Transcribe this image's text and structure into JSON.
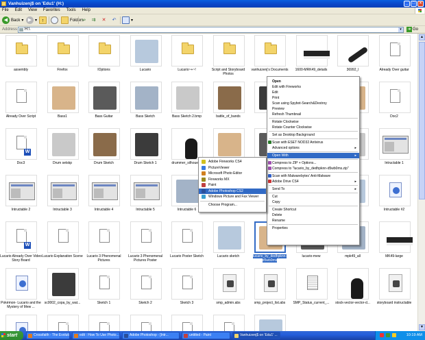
{
  "window": {
    "title": "Vanhuizenj$ on 'Edu1' (H:)",
    "controls": [
      "_",
      "□",
      "×"
    ]
  },
  "menu": [
    "File",
    "Edit",
    "View",
    "Favorites",
    "Tools",
    "Help"
  ],
  "toolbar": {
    "back_label": "Back",
    "folders_label": "Folders"
  },
  "address": {
    "label": "Address",
    "value": "H:\\",
    "go_label": "Go"
  },
  "files": [
    {
      "label": "assembly",
      "icon": "folder"
    },
    {
      "label": "Firefox",
      "icon": "folder"
    },
    {
      "label": "IOptions",
      "icon": "folder"
    },
    {
      "label": "Lucario",
      "icon": "image"
    },
    {
      "label": "Lucario~+~!",
      "icon": "folder"
    },
    {
      "label": "Script and Storyboard Photos",
      "icon": "folder"
    },
    {
      "label": "vanhuizenj's Documents",
      "icon": "folder"
    },
    {
      "label": "1600-MRK49_details",
      "icon": "image"
    },
    {
      "label": "36992_l",
      "icon": "image"
    },
    {
      "label": "Already Over guitar",
      "icon": "doc"
    },
    {
      "label": "Already Over Script",
      "icon": "doc"
    },
    {
      "label": "Bass1",
      "icon": "image"
    },
    {
      "label": "Bass Guitar",
      "icon": "image"
    },
    {
      "label": "Bass Sketch",
      "icon": "image"
    },
    {
      "label": "Bass Sketch 2.bmp",
      "icon": "image"
    },
    {
      "label": "battle_of_bands",
      "icon": "image"
    },
    {
      "label": "d",
      "icon": "image"
    },
    {
      "label": "",
      "icon": "image"
    },
    {
      "label": "",
      "icon": "image"
    },
    {
      "label": "Doc2",
      "icon": "doc"
    },
    {
      "label": "Doc3",
      "icon": "word"
    },
    {
      "label": "Drum setskp",
      "icon": "image"
    },
    {
      "label": "Drum Sketch",
      "icon": "image"
    },
    {
      "label": "Drum Sketch 1",
      "icon": "image"
    },
    {
      "label": "drummer_silhouette",
      "icon": "image"
    },
    {
      "label": "",
      "icon": "image"
    },
    {
      "label": "",
      "icon": "image"
    },
    {
      "label": "",
      "icon": "image"
    },
    {
      "label": "",
      "icon": "image"
    },
    {
      "label": "Intructable 1",
      "icon": "screen"
    },
    {
      "label": "Intructable 2",
      "icon": "screen"
    },
    {
      "label": "Intructable 3",
      "icon": "screen"
    },
    {
      "label": "Intructable 4",
      "icon": "screen"
    },
    {
      "label": "Intructable 5",
      "icon": "screen"
    },
    {
      "label": "Intructable 6",
      "icon": "image"
    },
    {
      "label": "",
      "icon": "image"
    },
    {
      "label": "",
      "icon": "image"
    },
    {
      "label": "",
      "icon": "image"
    },
    {
      "label": "",
      "icon": "image"
    },
    {
      "label": "Intructable #2",
      "icon": "setup"
    },
    {
      "label": "Lucario Already Over Video Story Board",
      "icon": "word"
    },
    {
      "label": "Lucario Explanation Scene",
      "icon": "doc"
    },
    {
      "label": "Lucario 3 Phenomenal Pictures",
      "icon": "doc"
    },
    {
      "label": "Lucario 3 Phenomenal Pictures Poster",
      "icon": "doc"
    },
    {
      "label": "Lucario Poster Sketch",
      "icon": "doc"
    },
    {
      "label": "Lucario sketch",
      "icon": "image"
    },
    {
      "label": "lucario_by_dedhpknn-d5wb0ms",
      "icon": "image"
    },
    {
      "label": "lucario-mew",
      "icon": "image"
    },
    {
      "label": "mpk49_all",
      "icon": "image"
    },
    {
      "label": "MK49-large",
      "icon": "image"
    },
    {
      "label": "Pokémon- Lucario and the Mystery of Mew ...",
      "icon": "setup"
    },
    {
      "label": "sc0002_copa_by_wat...",
      "icon": "image"
    },
    {
      "label": "Sketch 1",
      "icon": "doc"
    },
    {
      "label": "Sketch 2",
      "icon": "doc"
    },
    {
      "label": "Sketch 3",
      "icon": "doc"
    },
    {
      "label": "smp_admin.abs",
      "icon": "util"
    },
    {
      "label": "smp_project_list.abs",
      "icon": "util"
    },
    {
      "label": "SMP_Status_current_...",
      "icon": "txt"
    },
    {
      "label": "stock-vector-vector-d...",
      "icon": "image"
    },
    {
      "label": "storyboard instructable",
      "icon": "util"
    },
    {
      "label": "",
      "icon": "setup"
    },
    {
      "label": "",
      "icon": "doc"
    },
    {
      "label": "",
      "icon": "doc"
    },
    {
      "label": "",
      "icon": "doc"
    },
    {
      "label": "",
      "icon": "doc"
    },
    {
      "label": "",
      "icon": "doc"
    },
    {
      "label": "",
      "icon": "image"
    }
  ],
  "context_menu": {
    "items": [
      {
        "label": "Open",
        "bold": true
      },
      {
        "label": "Edit with Fireworks"
      },
      {
        "label": "Edit"
      },
      {
        "label": "Print"
      },
      {
        "label": "Scan using Spybot-Search&Destroy"
      },
      {
        "label": "Preview"
      },
      {
        "label": "Refresh Thumbnail"
      },
      {
        "sep": true
      },
      {
        "label": "Rotate Clockwise"
      },
      {
        "label": "Rotate Counter Clockwise"
      },
      {
        "sep": true
      },
      {
        "label": "Set as Desktop Background"
      },
      {
        "sep": true
      },
      {
        "label": "Scan with ESET NOD32 Antivirus",
        "icon": "#2a7a2a"
      },
      {
        "label": "Advanced options",
        "submenu": true
      },
      {
        "sep": true
      },
      {
        "label": "Open With",
        "submenu": true,
        "highlight": true
      },
      {
        "sep": true
      },
      {
        "label": "Compress to ZIP + Options...",
        "icon": "#a050b0"
      },
      {
        "label": "Compress to \"lucario_by_dedhpknn-d5wb0ms.zip\"",
        "icon": "#a050b0"
      },
      {
        "sep": true
      },
      {
        "label": "Scan with Malwarebytes' Anti-Malware",
        "icon": "#2f5fc8"
      },
      {
        "label": "Adobe Drive CS4",
        "submenu": true,
        "icon": "#c33"
      },
      {
        "sep": true
      },
      {
        "label": "Send To",
        "submenu": true
      },
      {
        "sep": true
      },
      {
        "label": "Cut"
      },
      {
        "label": "Copy"
      },
      {
        "sep": true
      },
      {
        "label": "Create Shortcut"
      },
      {
        "label": "Delete"
      },
      {
        "label": "Rename"
      },
      {
        "sep": true
      },
      {
        "label": "Properties"
      }
    ]
  },
  "open_with_menu": {
    "items": [
      {
        "label": "Adobe Fireworks CS4",
        "icon": "#d2c020"
      },
      {
        "label": "PictureViewer",
        "icon": "#3a7ae0"
      },
      {
        "label": "Microsoft Photo Editor",
        "icon": "#d08020"
      },
      {
        "label": "Fireworks MX",
        "icon": "#9a8a20"
      },
      {
        "label": "Paint",
        "icon": "#c04040"
      },
      {
        "label": "Adobe Photoshop CS2",
        "icon": "#2a4f9a",
        "highlight": true
      },
      {
        "label": "Windows Picture and Fax Viewer",
        "icon": "#3aa0d0"
      },
      {
        "sep": true
      },
      {
        "label": "Choose Program..."
      }
    ]
  },
  "taskbar": {
    "start_label": "start",
    "tasks": [
      {
        "label": "Crossfaith - The Evolutio...",
        "icon": "#e07a20"
      },
      {
        "label": "edit : How To Use Photo...",
        "icon": "#e07a20"
      },
      {
        "label": "Adobe Photoshop - [Intr...",
        "icon": "#2a4f9a"
      },
      {
        "label": "untitled - Paint",
        "icon": "#c04040"
      },
      {
        "label": "Vanhuizenj$ on 'Edu1' ...",
        "icon": "#f3d46a",
        "active": true
      }
    ],
    "clock": "10:19 AM"
  },
  "colors": {
    "titlebar": "#0a46c8",
    "selection": "#316ac5",
    "chrome": "#ece9d8",
    "taskbar": "#245edb",
    "start": "#3a9a3a"
  }
}
